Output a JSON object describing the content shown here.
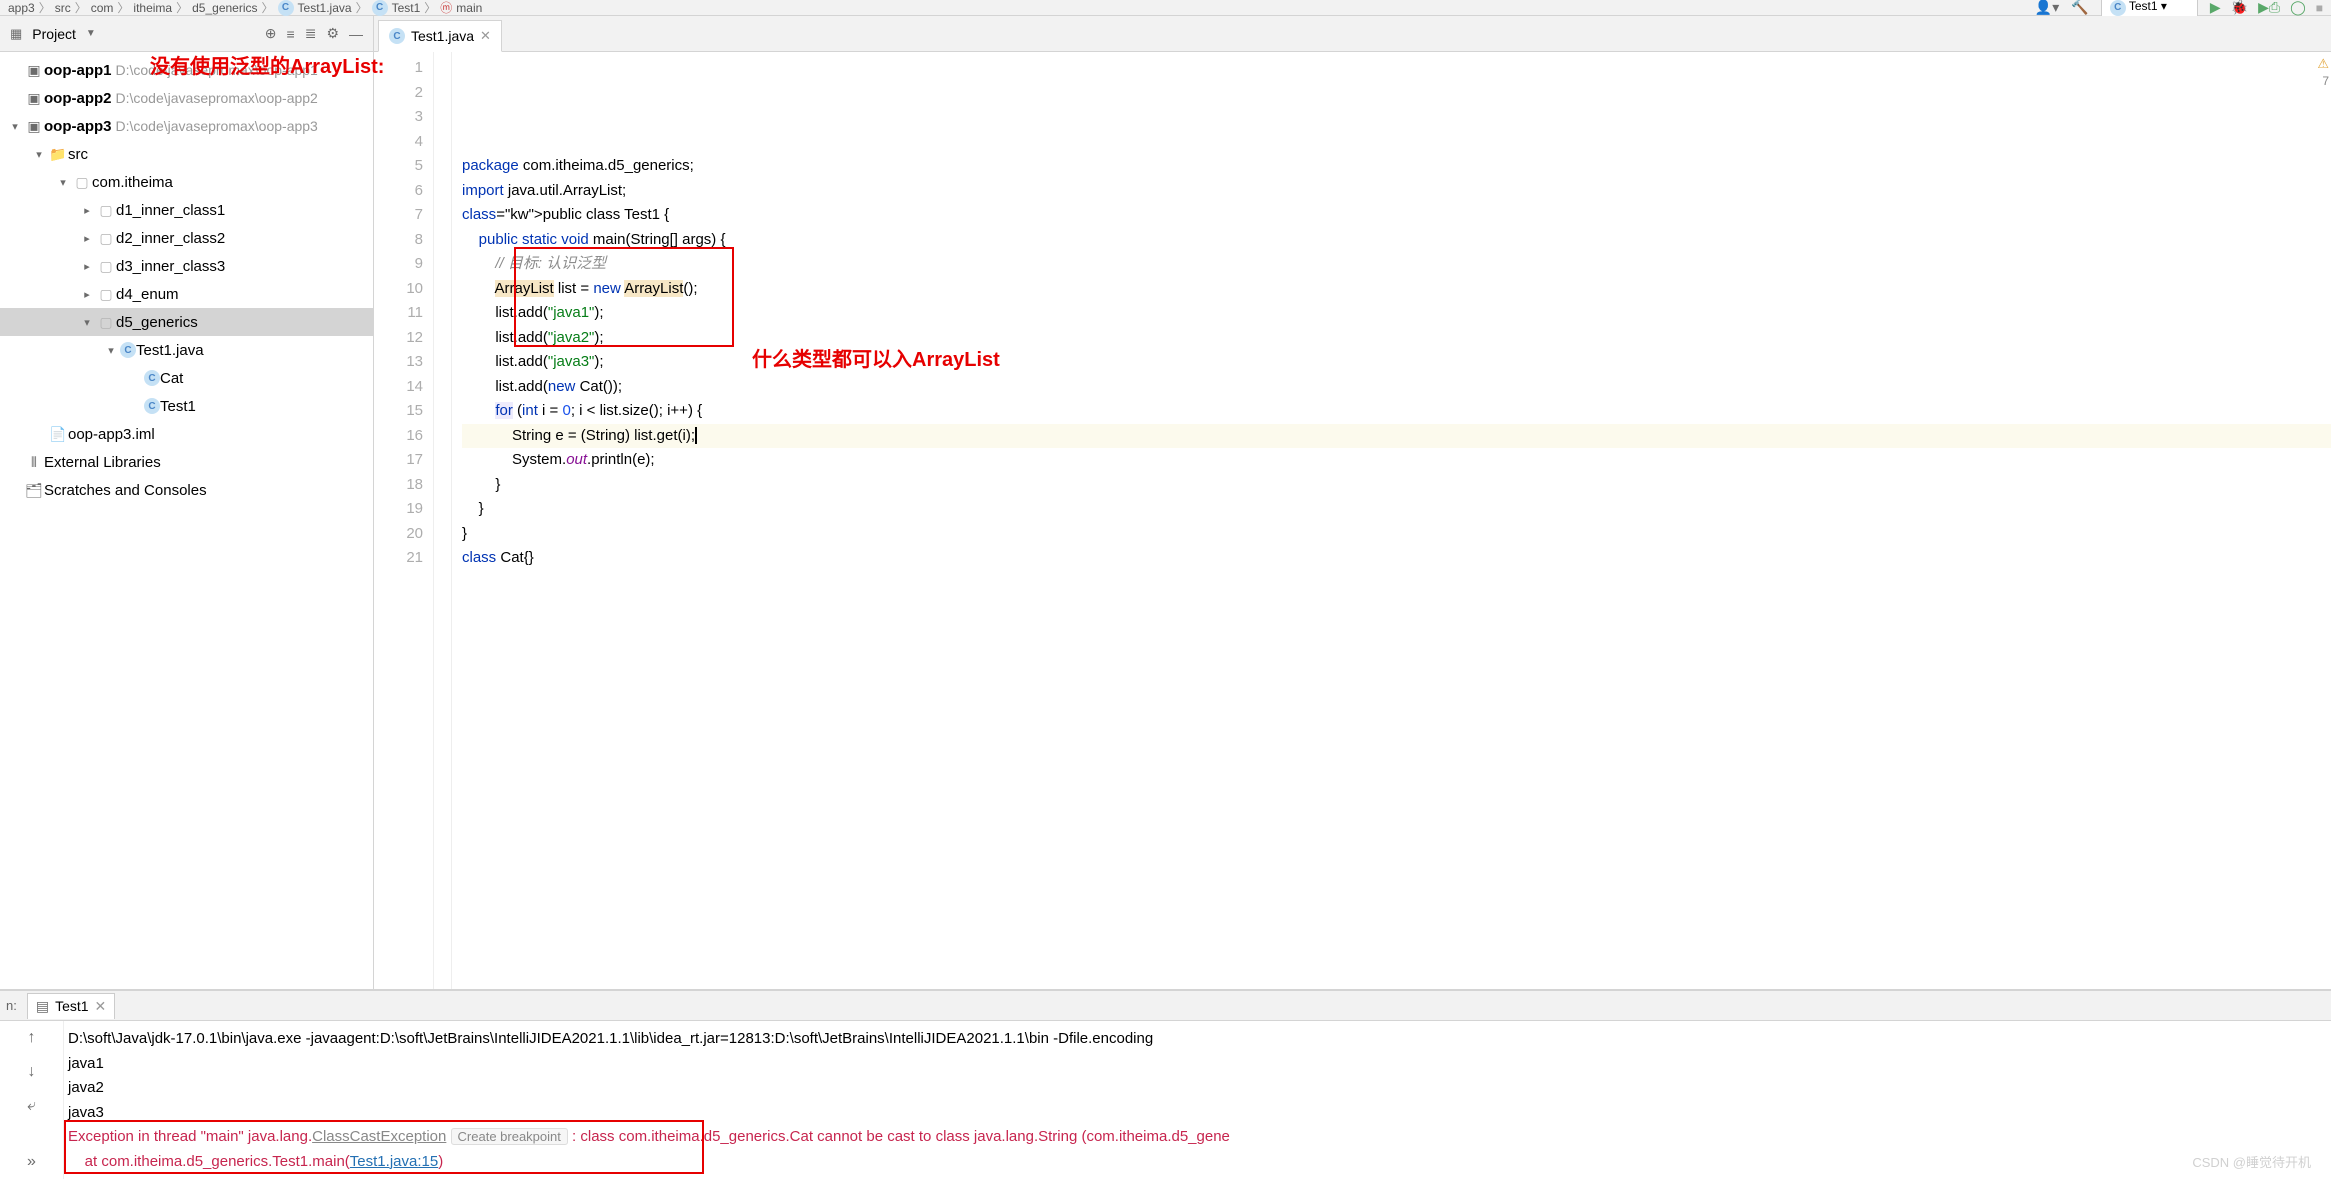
{
  "breadcrumbs": [
    "app3",
    "src",
    "com",
    "itheima",
    "d5_generics",
    "Test1.java",
    "Test1",
    "main"
  ],
  "run_config": "Test1",
  "sidebar": {
    "title": "Project",
    "items": [
      {
        "name": "oop-app1",
        "path": "D:\\code\\javasepromax\\oop-app1",
        "ico": "mod",
        "depth": 0,
        "bold": true
      },
      {
        "name": "oop-app2",
        "path": "D:\\code\\javasepromax\\oop-app2",
        "ico": "mod",
        "depth": 0,
        "bold": true
      },
      {
        "name": "oop-app3",
        "path": "D:\\code\\javasepromax\\oop-app3",
        "ico": "mod",
        "depth": 0,
        "bold": true,
        "arr": "▾"
      },
      {
        "name": "src",
        "ico": "folder",
        "depth": 1,
        "bold": false,
        "arr": "▾"
      },
      {
        "name": "com.itheima",
        "ico": "pkg",
        "depth": 2,
        "arr": "▾"
      },
      {
        "name": "d1_inner_class1",
        "ico": "pkg",
        "depth": 3,
        "arr": "▸"
      },
      {
        "name": "d2_inner_class2",
        "ico": "pkg",
        "depth": 3,
        "arr": "▸"
      },
      {
        "name": "d3_inner_class3",
        "ico": "pkg",
        "depth": 3,
        "arr": "▸"
      },
      {
        "name": "d4_enum",
        "ico": "pkg",
        "depth": 3,
        "arr": "▸"
      },
      {
        "name": "d5_generics",
        "ico": "pkg",
        "depth": 3,
        "arr": "▾",
        "sel": true
      },
      {
        "name": "Test1.java",
        "ico": "class",
        "depth": 4,
        "arr": "▾"
      },
      {
        "name": "Cat",
        "ico": "class",
        "depth": 5
      },
      {
        "name": "Test1",
        "ico": "class",
        "depth": 5
      },
      {
        "name": "oop-app3.iml",
        "ico": "file",
        "depth": 1
      },
      {
        "name": "External Libraries",
        "ico": "lib",
        "depth": -1
      },
      {
        "name": "Scratches and Consoles",
        "ico": "scratch",
        "depth": -1
      }
    ]
  },
  "tab": {
    "label": "Test1.java"
  },
  "annotations": {
    "a1": "没有使用泛型的ArrayList:",
    "a2": "什么类型都可以入ArrayList"
  },
  "code": {
    "lines": [
      {
        "n": 1,
        "t": "package com.itheima.d5_generics;",
        "k": [
          "package"
        ]
      },
      {
        "n": 2,
        "t": ""
      },
      {
        "n": 3,
        "t": "import java.util.ArrayList;",
        "k": [
          "import"
        ]
      },
      {
        "n": 4,
        "t": ""
      },
      {
        "n": 5,
        "t": "public class Test1 {",
        "k": [
          "public",
          "class"
        ],
        "run": true
      },
      {
        "n": 6,
        "t": "    public static void main(String[] args) {",
        "k": [
          "public",
          "static",
          "void"
        ],
        "run": true
      },
      {
        "n": 7,
        "t": "        // 目标: 认识泛型",
        "com": true
      },
      {
        "n": 8,
        "t": "        ArrayList list = new ArrayList();",
        "k": [
          "new"
        ],
        "hl": [
          "ArrayList"
        ]
      },
      {
        "n": 9,
        "t": "        list.add(\"java1\");",
        "str": [
          "\"java1\""
        ]
      },
      {
        "n": 10,
        "t": "        list.add(\"java2\");",
        "str": [
          "\"java2\""
        ]
      },
      {
        "n": 11,
        "t": "        list.add(\"java3\");",
        "str": [
          "\"java3\""
        ]
      },
      {
        "n": 12,
        "t": "        list.add(new Cat());",
        "k": [
          "new"
        ]
      },
      {
        "n": 13,
        "t": ""
      },
      {
        "n": 14,
        "t": "        for (int i = 0; i < list.size(); i++) {",
        "k": [
          "for",
          "int"
        ],
        "num": [
          "0"
        ],
        "hlf": true
      },
      {
        "n": 15,
        "t": "            String e = (String) list.get(i);",
        "cursor": true
      },
      {
        "n": 16,
        "t": "            System.out.println(e);",
        "fld": [
          "out"
        ]
      },
      {
        "n": 17,
        "t": "        }"
      },
      {
        "n": 18,
        "t": "    }"
      },
      {
        "n": 19,
        "t": "}"
      },
      {
        "n": 20,
        "t": ""
      },
      {
        "n": 21,
        "t": "class Cat{}",
        "k": [
          "class"
        ]
      }
    ]
  },
  "warnings": "7",
  "run_tab": "Test1",
  "create_breakpoint": "Create breakpoint",
  "console": {
    "cmd": "D:\\soft\\Java\\jdk-17.0.1\\bin\\java.exe -javaagent:D:\\soft\\JetBrains\\IntelliJIDEA2021.1.1\\lib\\idea_rt.jar=12813:D:\\soft\\JetBrains\\IntelliJIDEA2021.1.1\\bin -Dfile.encoding",
    "out": [
      "java1",
      "java2",
      "java3"
    ],
    "err1a": "Exception in thread \"main\" java.lang.",
    "err1b": "ClassCastException",
    "err1c": ": class com.itheima.d5_generics.Cat cannot be cast to class java.lang.String (com.itheima.d5_gene",
    "err2a": "    at com.itheima.d5_generics.Test1.main(",
    "err2b": "Test1.java:15",
    "err2c": ")"
  },
  "watermark": "CSDN @睡觉待开机"
}
